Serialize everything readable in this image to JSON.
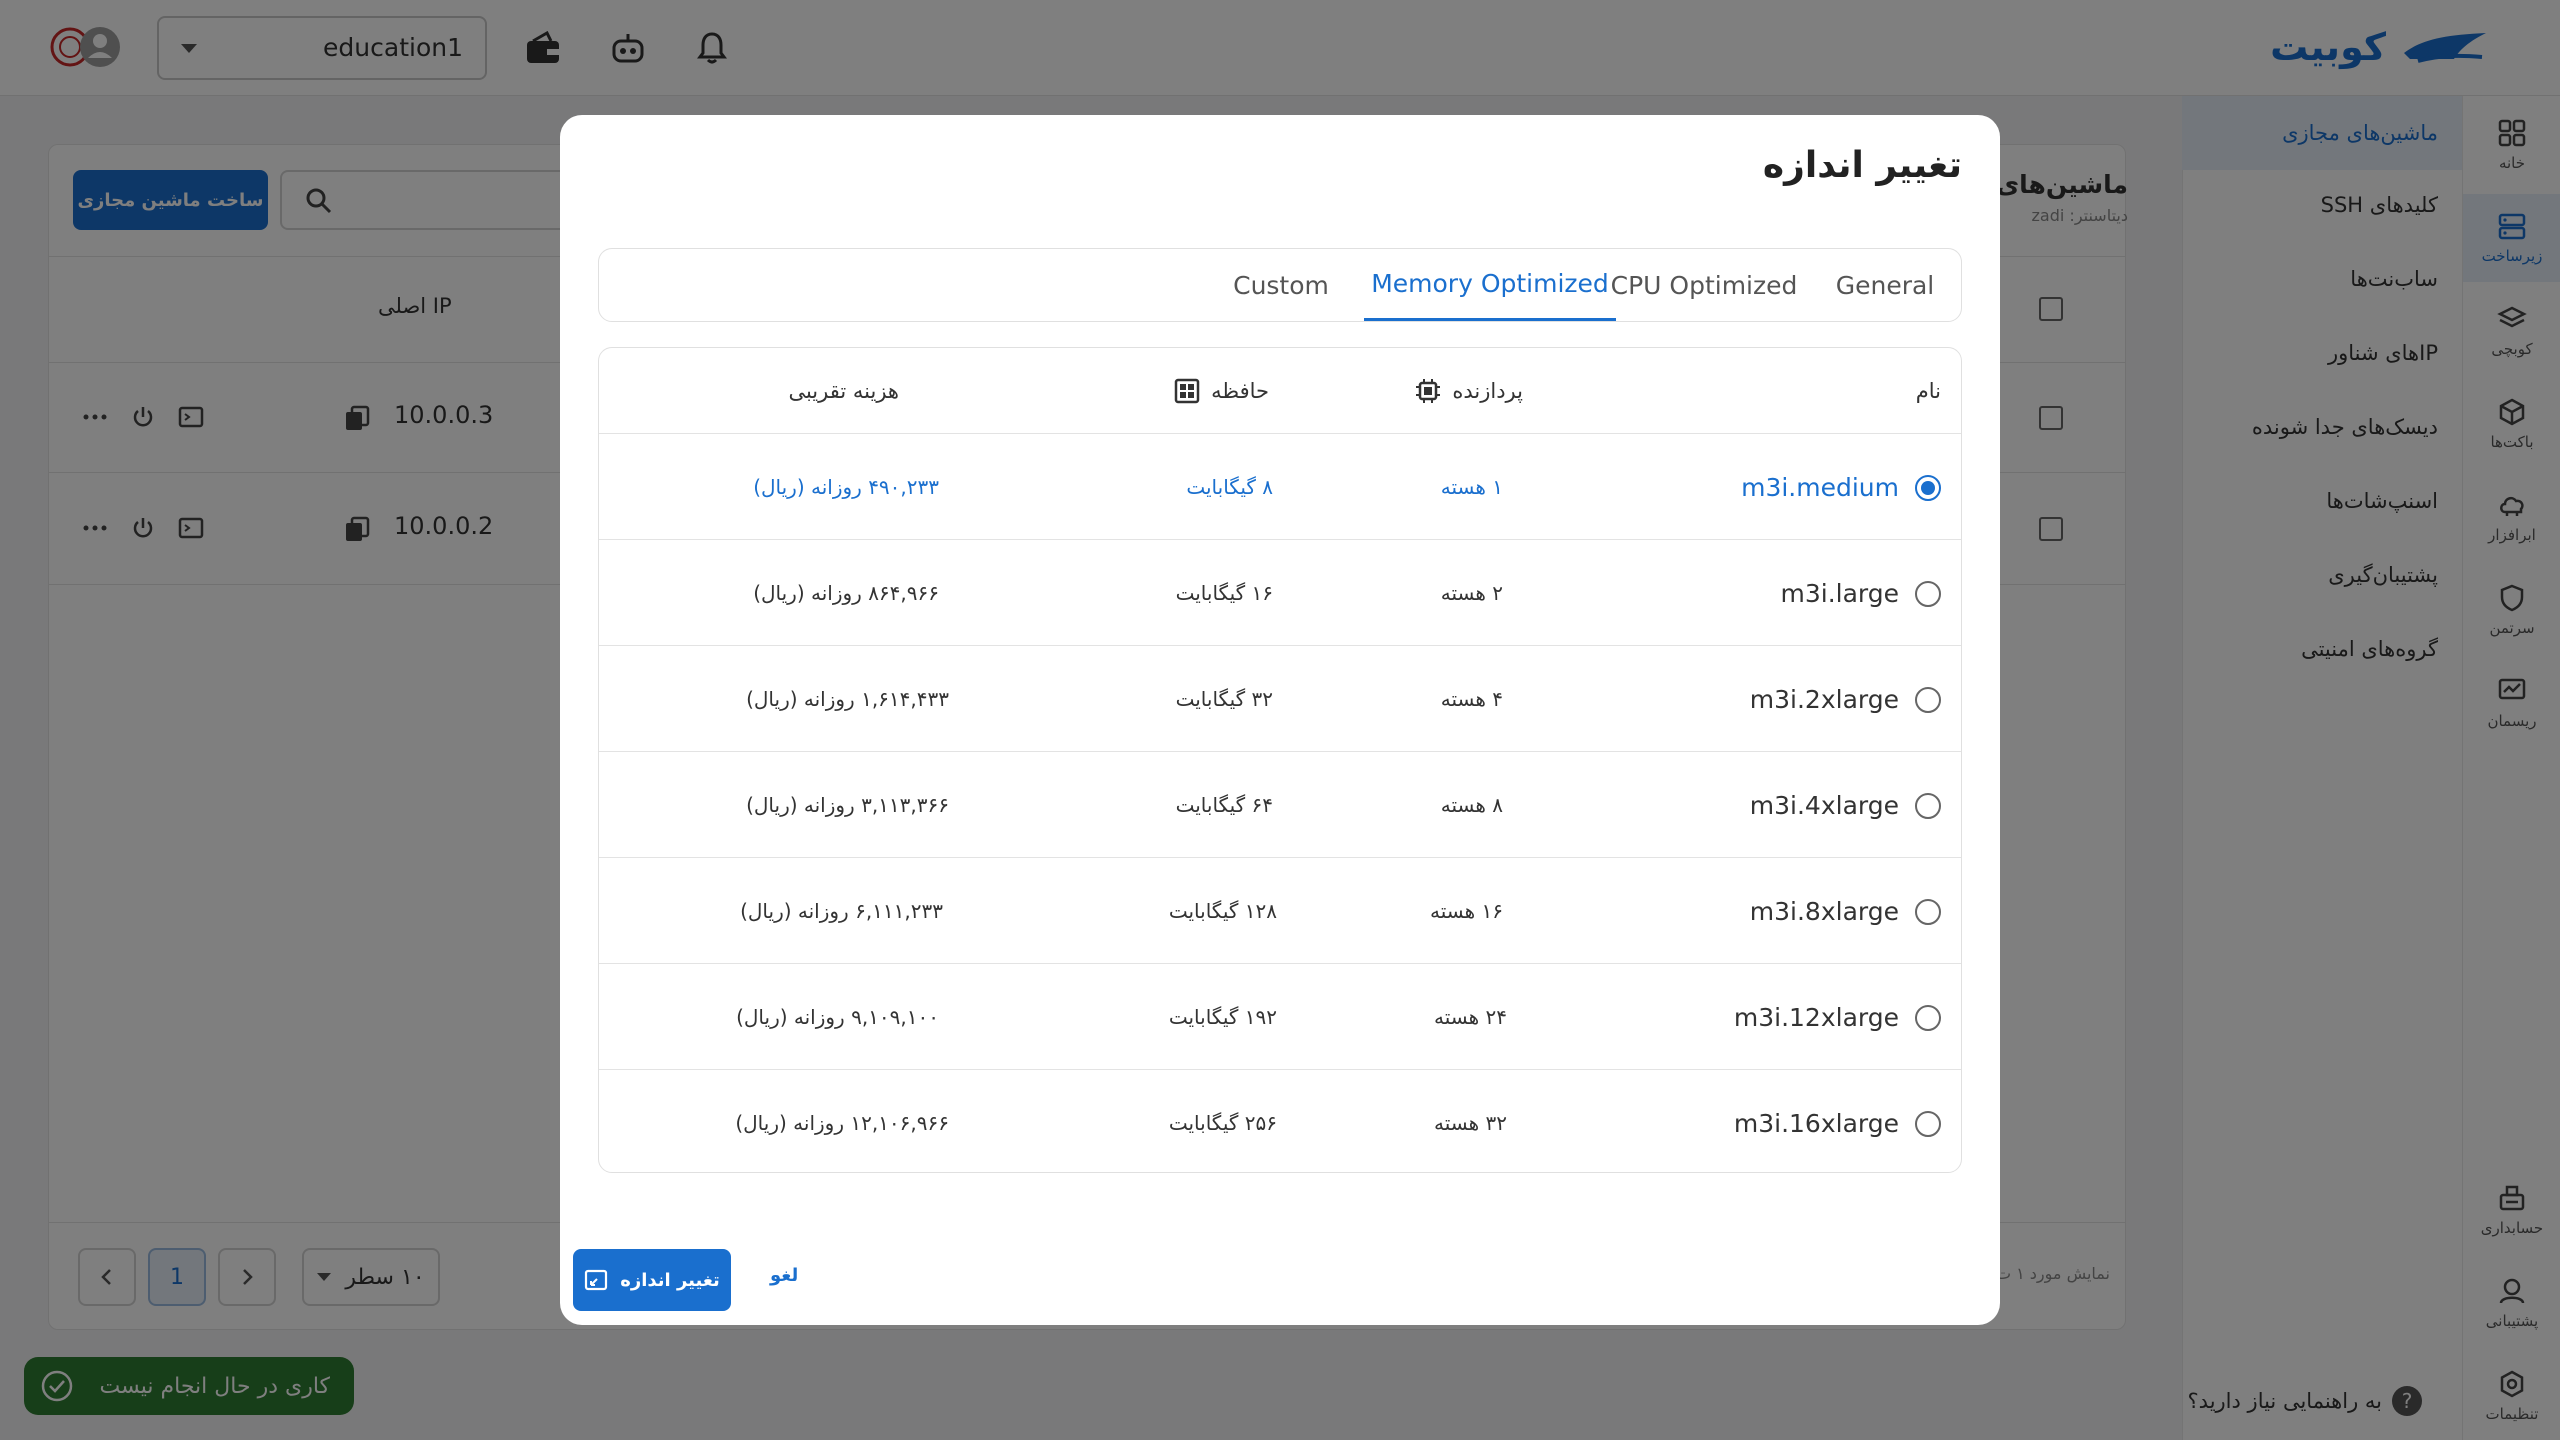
{
  "brand": {
    "name": "کوبیت"
  },
  "topbar": {
    "project_value": "education1"
  },
  "rail": {
    "items": [
      {
        "label": "خانه"
      },
      {
        "label": "زیرساخت"
      },
      {
        "label": "کوبچی"
      },
      {
        "label": "باکت‌ها"
      },
      {
        "label": "ابرافزار"
      },
      {
        "label": "سرتمن"
      },
      {
        "label": "ریسمان"
      },
      {
        "label": "حسابداری"
      },
      {
        "label": "پشتیبانی"
      },
      {
        "label": "تنظیمات"
      }
    ]
  },
  "side_menu": {
    "items": [
      {
        "label": "ماشین‌های مجازی"
      },
      {
        "label": "کلیدهای SSH"
      },
      {
        "label": "ساب‌نت‌ها"
      },
      {
        "label": "IPهای شناور"
      },
      {
        "label": "دیسک‌های جدا شونده"
      },
      {
        "label": "اسنپ‌شات‌ها"
      },
      {
        "label": "پشتیبان‌گیری"
      },
      {
        "label": "گروه‌های امنیتی"
      }
    ],
    "help": "به راهنمایی نیاز دارید؟",
    "help_mark": "?"
  },
  "background": {
    "create_button": "ساخت ماشین مجازی",
    "title": "ماشین‌های",
    "subtitle": "دیتاسنتر: zadi",
    "ip_header": "IP اصلی",
    "rows": [
      {
        "ip": "10.0.0.3"
      },
      {
        "ip": "10.0.0.2"
      }
    ],
    "pager": {
      "rows_per_page": "۱۰ سطر",
      "current_page": "1"
    },
    "footnote": "نمایش مورد ۱ ت"
  },
  "toast": {
    "text": "کاری در حال انجام نیست"
  },
  "modal": {
    "title": "تغییر اندازه",
    "tabs": [
      {
        "label": "General",
        "active": false
      },
      {
        "label": "CPU Optimized",
        "active": false
      },
      {
        "label": "Memory Optimized",
        "active": true
      },
      {
        "label": "Custom",
        "active": false
      }
    ],
    "table": {
      "headers": {
        "name": "نام",
        "cpu": "پردازنده",
        "memory": "حافظه",
        "cost": "هزینه تقریبی"
      },
      "rows": [
        {
          "name": "m3i.medium",
          "cpu": "۱ هسته",
          "memory": "۸ گیگابایت",
          "cost": "۴۹۰,۲۳۳ روزانه (ریال)",
          "selected": true
        },
        {
          "name": "m3i.large",
          "cpu": "۲ هسته",
          "memory": "۱۶ گیگابایت",
          "cost": "۸۶۴,۹۶۶ روزانه (ریال)",
          "selected": false
        },
        {
          "name": "m3i.2xlarge",
          "cpu": "۴ هسته",
          "memory": "۳۲ گیگابایت",
          "cost": "۱,۶۱۴,۴۳۳ روزانه (ریال)",
          "selected": false
        },
        {
          "name": "m3i.4xlarge",
          "cpu": "۸ هسته",
          "memory": "۶۴ گیگابایت",
          "cost": "۳,۱۱۳,۳۶۶ روزانه (ریال)",
          "selected": false
        },
        {
          "name": "m3i.8xlarge",
          "cpu": "۱۶ هسته",
          "memory": "۱۲۸ گیگابایت",
          "cost": "۶,۱۱۱,۲۳۳ روزانه (ریال)",
          "selected": false
        },
        {
          "name": "m3i.12xlarge",
          "cpu": "۲۴ هسته",
          "memory": "۱۹۲ گیگابایت",
          "cost": "۹,۱۰۹,۱۰۰ روزانه (ریال)",
          "selected": false
        },
        {
          "name": "m3i.16xlarge",
          "cpu": "۳۲ هسته",
          "memory": "۲۵۶ گیگابایت",
          "cost": "۱۲,۱۰۶,۹۶۶ روزانه (ریال)",
          "selected": false
        }
      ]
    },
    "primary_button": "تغییر اندازه",
    "cancel_button": "لغو"
  },
  "colors": {
    "accent": "#1a6fce",
    "toast": "#2e7d32",
    "overlay": "rgba(0,0,0,0.5)"
  }
}
